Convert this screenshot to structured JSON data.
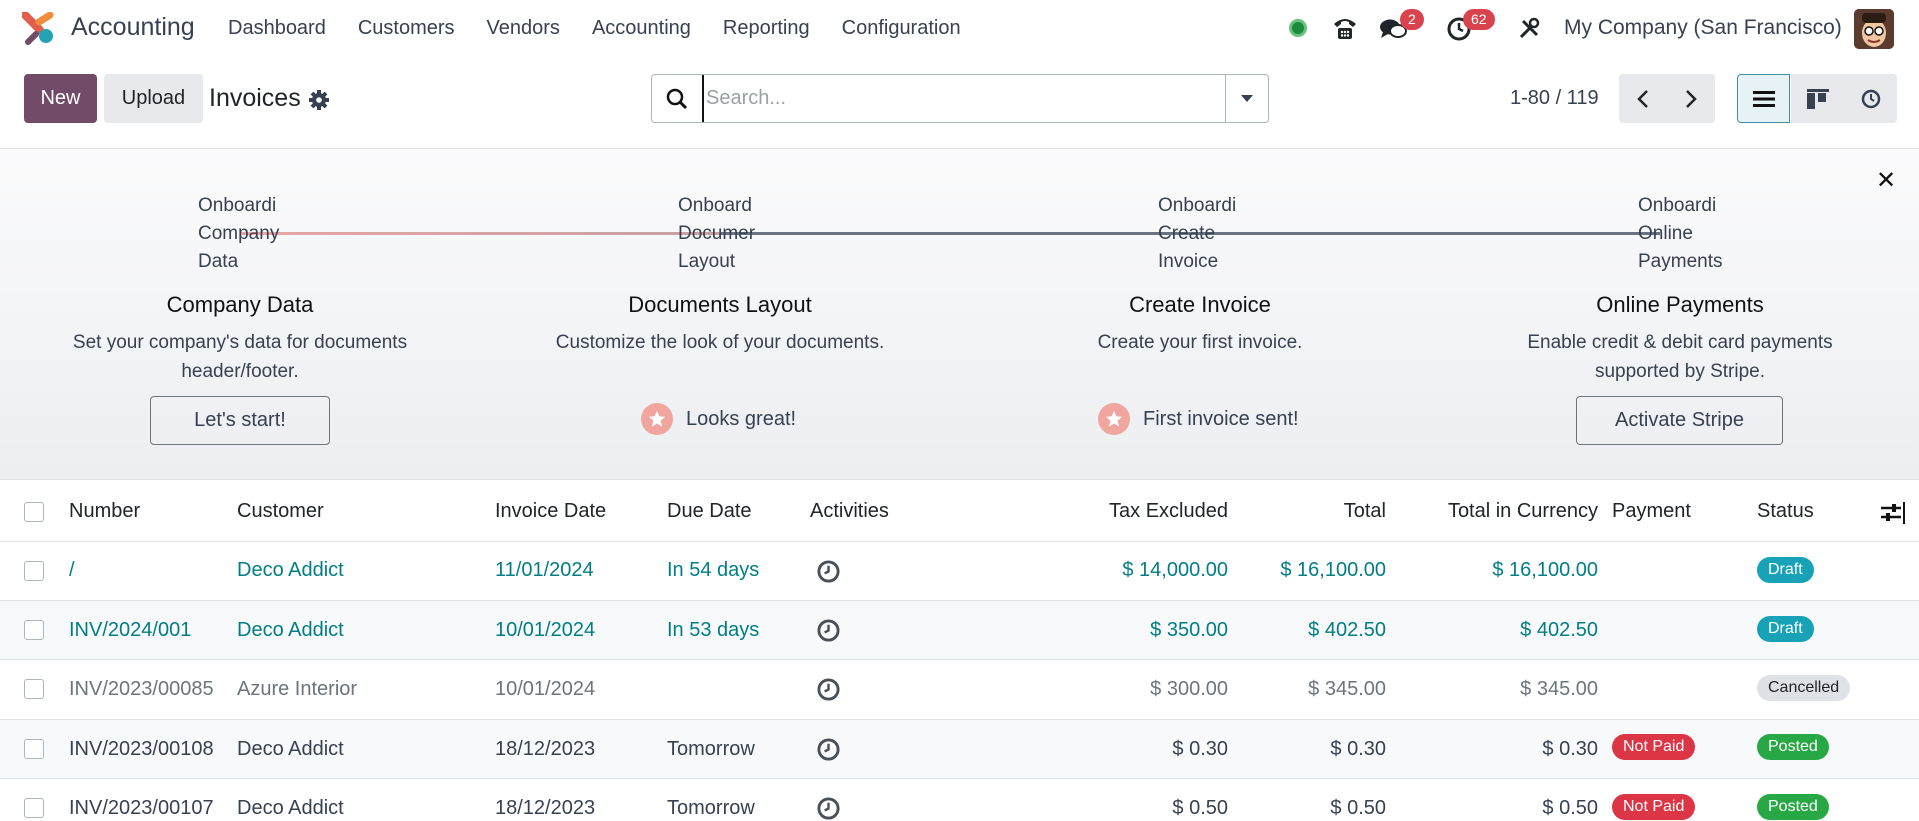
{
  "app": {
    "name": "Accounting"
  },
  "nav": {
    "items": [
      "Dashboard",
      "Customers",
      "Vendors",
      "Accounting",
      "Reporting",
      "Configuration"
    ]
  },
  "systray": {
    "messages_count": "2",
    "activities_count": "62",
    "company": "My Company (San Francisco)"
  },
  "controls": {
    "new_label": "New",
    "upload_label": "Upload",
    "title": "Invoices",
    "search_placeholder": "Search...",
    "pager": "1-80 / 119"
  },
  "onboarding": {
    "steps": [
      {
        "lines": [
          "Onboardi",
          "Company",
          "Data"
        ],
        "title": "Company Data",
        "desc": "Set your company's data for documents header/footer.",
        "action": "Let's start!",
        "done": false
      },
      {
        "lines": [
          "Onboard",
          "Documer",
          "Layout"
        ],
        "title": "Documents Layout",
        "desc": "Customize the look of your documents.",
        "action": "Looks great!",
        "done": true
      },
      {
        "lines": [
          "Onboardi",
          "Create",
          "Invoice"
        ],
        "title": "Create Invoice",
        "desc": "Create your first invoice.",
        "action": "First invoice sent!",
        "done": true
      },
      {
        "lines": [
          "Onboardi",
          "Online",
          "Payments"
        ],
        "title": "Online Payments",
        "desc": "Enable credit & debit card payments supported by Stripe.",
        "action": "Activate Stripe",
        "done": false
      }
    ]
  },
  "table": {
    "columns": [
      "Number",
      "Customer",
      "Invoice Date",
      "Due Date",
      "Activities",
      "Tax Excluded",
      "Total",
      "Total in Currency",
      "Payment",
      "Status"
    ],
    "rows": [
      {
        "number": "/",
        "customer": "Deco Addict",
        "invoice_date": "11/01/2024",
        "due_date": "In 54 days",
        "tax_excluded": "$ 14,000.00",
        "total": "$ 16,100.00",
        "total_currency": "$ 16,100.00",
        "payment": "",
        "status": "Draft"
      },
      {
        "number": "INV/2024/001",
        "customer": "Deco Addict",
        "invoice_date": "10/01/2024",
        "due_date": "In 53 days",
        "tax_excluded": "$ 350.00",
        "total": "$ 402.50",
        "total_currency": "$ 402.50",
        "payment": "",
        "status": "Draft"
      },
      {
        "number": "INV/2023/00085",
        "customer": "Azure Interior",
        "invoice_date": "10/01/2024",
        "due_date": "",
        "tax_excluded": "$ 300.00",
        "total": "$ 345.00",
        "total_currency": "$ 345.00",
        "payment": "",
        "status": "Cancelled"
      },
      {
        "number": "INV/2023/00108",
        "customer": "Deco Addict",
        "invoice_date": "18/12/2023",
        "due_date": "Tomorrow",
        "tax_excluded": "$ 0.30",
        "total": "$ 0.30",
        "total_currency": "$ 0.30",
        "payment": "Not Paid",
        "status": "Posted"
      },
      {
        "number": "INV/2023/00107",
        "customer": "Deco Addict",
        "invoice_date": "18/12/2023",
        "due_date": "Tomorrow",
        "tax_excluded": "$ 0.50",
        "total": "$ 0.50",
        "total_currency": "$ 0.50",
        "payment": "Not Paid",
        "status": "Posted"
      }
    ]
  },
  "colors": {
    "primary": "#714b67",
    "link": "#017e84",
    "draft": "#17a2b8",
    "posted": "#28a745",
    "not_paid": "#dc3545"
  }
}
